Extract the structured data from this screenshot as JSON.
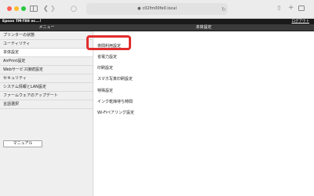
{
  "browser": {
    "url": "c02fm00fe0.local",
    "icons": [
      "sidebar-icon",
      "back-icon",
      "forward-icon",
      "shield-icon",
      "lock-icon",
      "reload-icon",
      "share-icon",
      "new-tab-icon",
      "tabs-overview-icon"
    ]
  },
  "header": {
    "printer_name": "Epson TM-T88 ec...!",
    "logout": "ログアウト",
    "menu_title": "メニュー",
    "section_title": "本体設定"
  },
  "sidebar": {
    "items": [
      {
        "label": "プリンターの状態"
      },
      {
        "label": "ユーティリティ"
      },
      {
        "label": "本体設定",
        "active": true
      },
      {
        "label": "AirPrint設定"
      },
      {
        "label": "Webサービス接続設定"
      },
      {
        "label": "セキュリティ"
      },
      {
        "label": "システム情報とLAN設定"
      },
      {
        "label": "ファームウェアのアップデート"
      },
      {
        "label": "言語選択"
      }
    ],
    "manual_button": "マニュアル"
  },
  "settings": {
    "items": [
      {
        "label": "夜間利用設定"
      },
      {
        "label": "省電力設定",
        "highlighted": true
      },
      {
        "label": "印刷設定"
      },
      {
        "label": "スマホ写真印刷設定"
      },
      {
        "label": "特殊設定"
      },
      {
        "label": "インク乾燥待ち時間"
      },
      {
        "label": "Wi-Fiペアリング設定"
      }
    ]
  },
  "colors": {
    "highlight": "#e12d2d",
    "header_bg": "#3a3a3a",
    "sidebar_bg": "#efefef"
  }
}
